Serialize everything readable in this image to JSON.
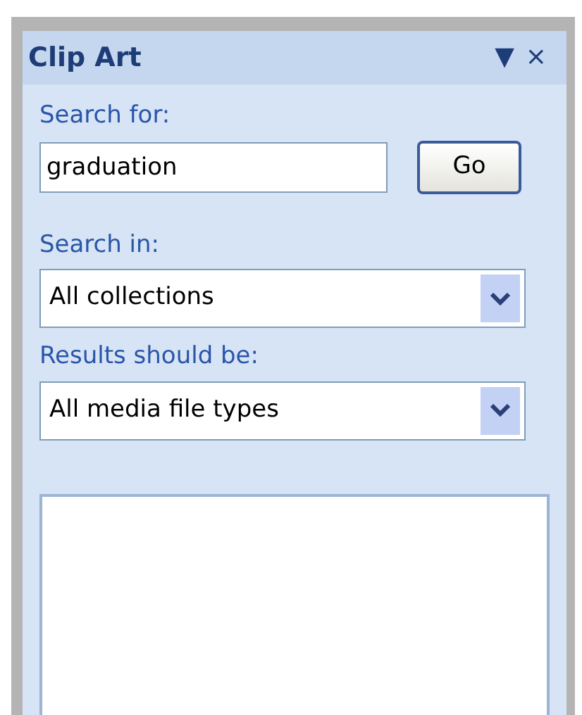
{
  "pane": {
    "title": "Clip Art",
    "menu_glyph": "▼",
    "close_glyph": "×"
  },
  "search_for": {
    "label": "Search for:",
    "value": "graduation",
    "button": "Go"
  },
  "search_in": {
    "label": "Search in:",
    "value": "All collections"
  },
  "results_type": {
    "label": "Results should be:",
    "value": "All media file types"
  },
  "results": {
    "kind": "empty"
  }
}
